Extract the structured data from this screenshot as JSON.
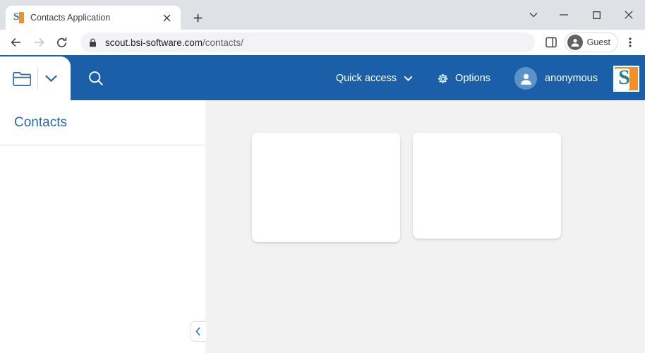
{
  "browser": {
    "tab": {
      "title": "Contacts Application",
      "favicon_name": "scout-s-favicon",
      "favicon_letter": "S",
      "close_label": "×"
    },
    "new_tab_label": "+",
    "window_controls": {
      "tab_search_label": "⌄",
      "minimize_label": "─",
      "maximize_label": "□",
      "close_label": "✕"
    },
    "toolbar": {
      "back_label": "←",
      "forward_label": "→",
      "reload_label": "⟳",
      "url_domain": "scout.bsi-software.com",
      "url_path": "/contacts/",
      "url_full": "scout.bsi-software.com/contacts/",
      "lock_icon_name": "site-secure-lock",
      "side_panel_icon_name": "side-panel-icon",
      "profile_label": "Guest",
      "menu_label": "⋮"
    }
  },
  "app": {
    "header": {
      "folder_icon_name": "folder-icon",
      "folder_chevron_label": "⌄",
      "search_icon_name": "search-icon",
      "quick_access_label": "Quick access",
      "quick_access_chevron": "⌄",
      "options_label": "Options",
      "options_icon_name": "gear-icon",
      "user_label": "anonymous",
      "brand_letter": "S",
      "accent_blue": "#1b5fa8",
      "brand_orange": "#f29027",
      "brand_teal": "#2d7d8c"
    },
    "sidebar": {
      "title": "Contacts",
      "collapse_label": "‹",
      "items": []
    },
    "content": {
      "background": "#f2f2f2",
      "cards": [
        {
          "name": "content-card-left",
          "body": ""
        },
        {
          "name": "content-card-right",
          "body": ""
        }
      ]
    }
  }
}
